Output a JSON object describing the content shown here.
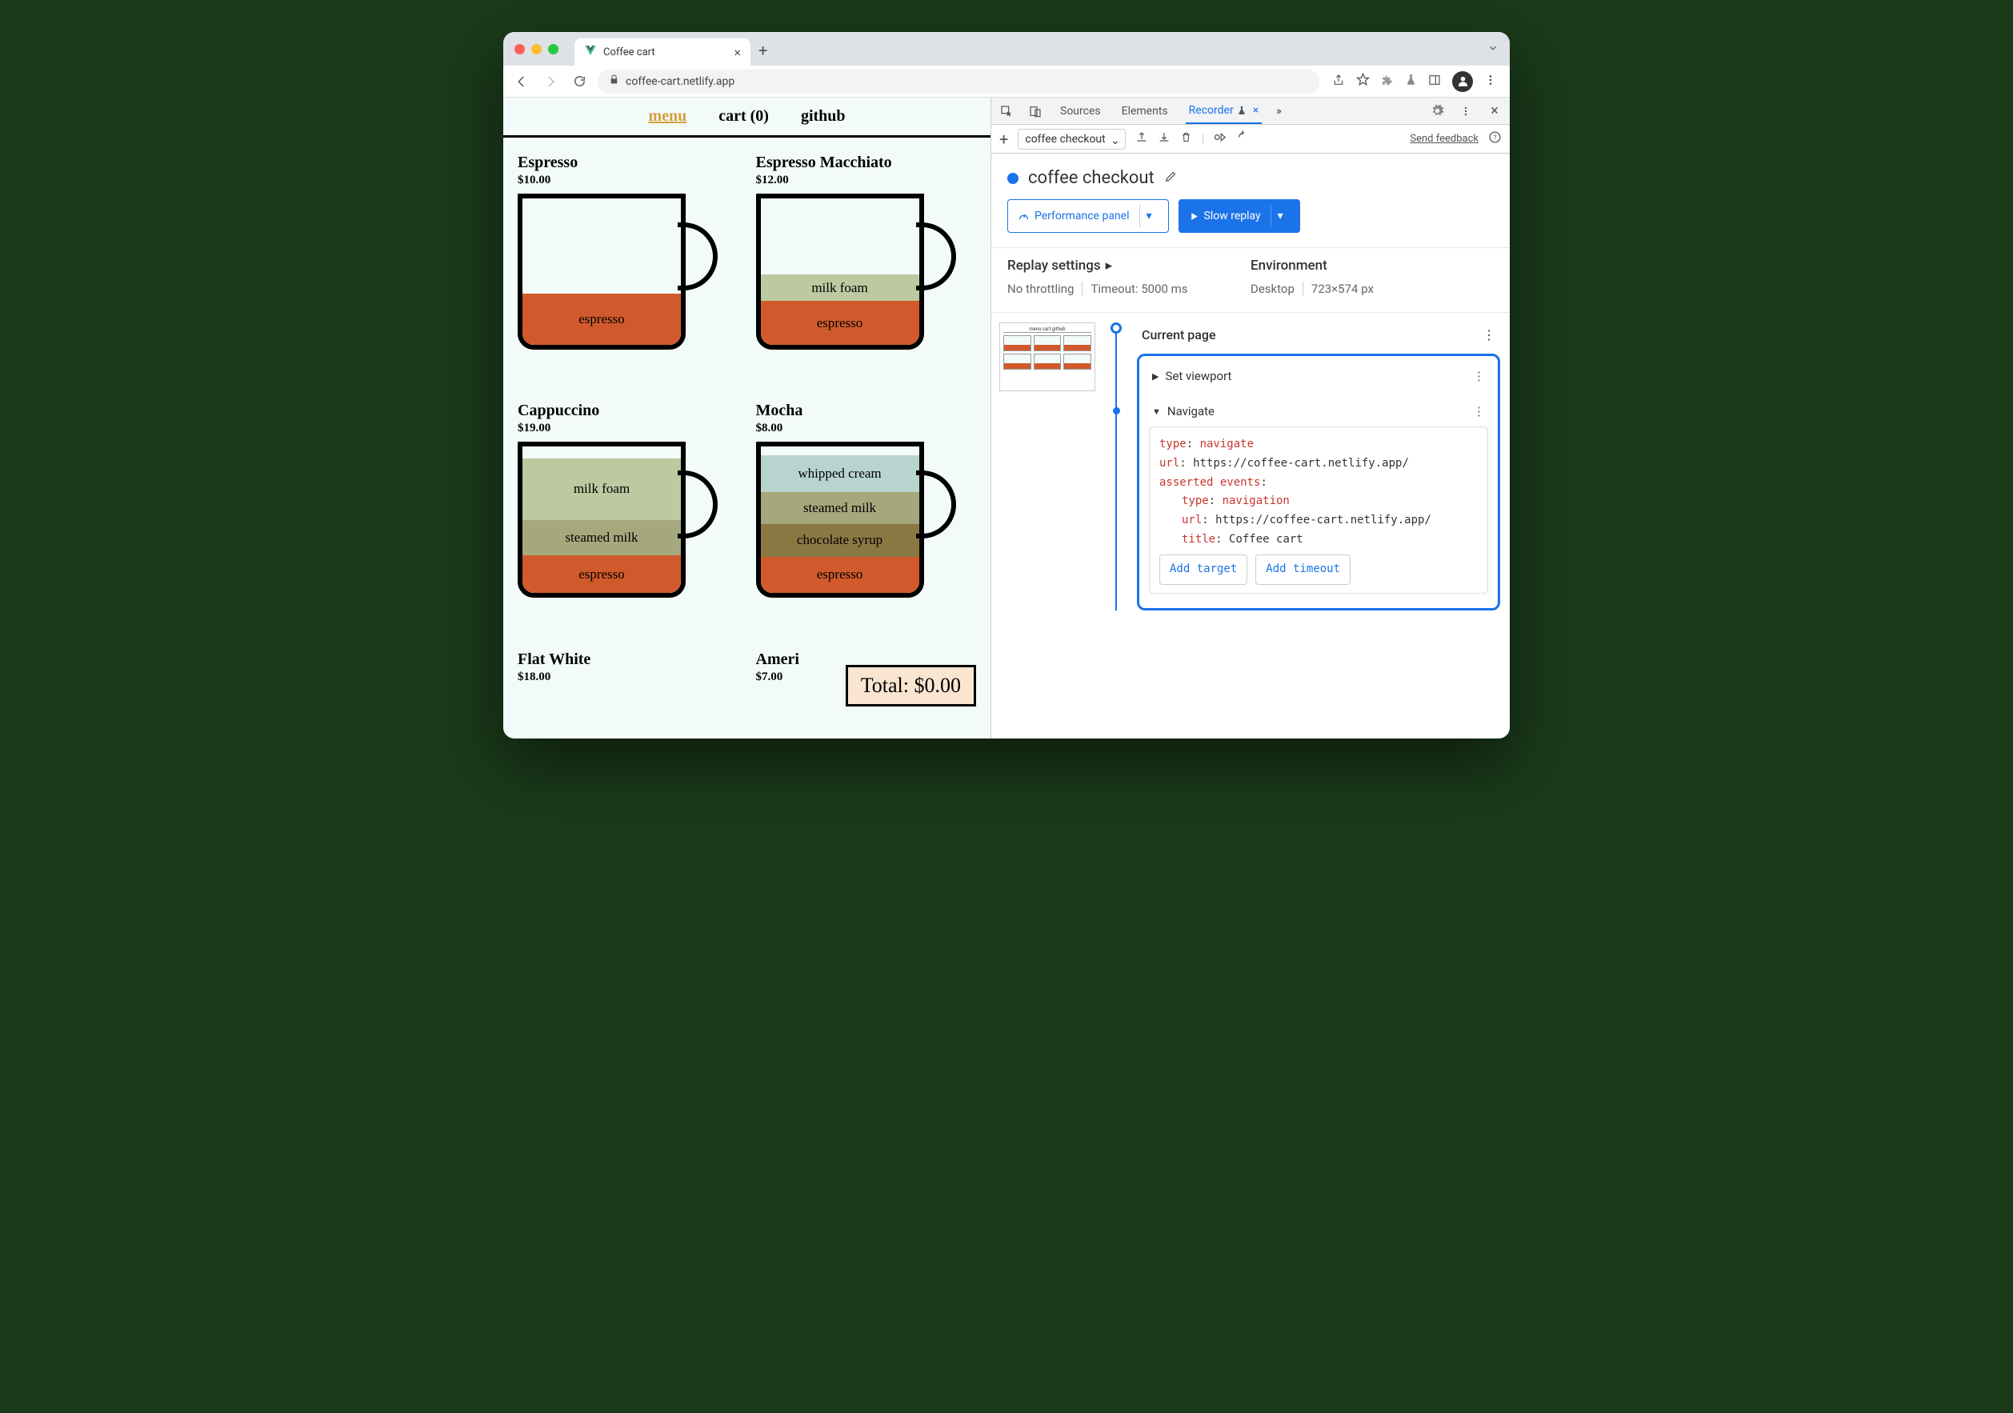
{
  "browser": {
    "tab_title": "Coffee cart",
    "url": "coffee-cart.netlify.app"
  },
  "page": {
    "nav": {
      "menu": "menu",
      "cart": "cart (0)",
      "github": "github"
    },
    "items": [
      {
        "name": "Espresso",
        "price": "$10.00"
      },
      {
        "name": "Espresso Macchiato",
        "price": "$12.00"
      },
      {
        "name": "Cappuccino",
        "price": "$19.00"
      },
      {
        "name": "Mocha",
        "price": "$8.00"
      },
      {
        "name": "Flat White",
        "price": "$18.00"
      },
      {
        "name": "Ameri",
        "price": "$7.00"
      }
    ],
    "layers": {
      "espresso": "espresso",
      "milkfoam": "milk foam",
      "steamedmilk": "steamed milk",
      "whipped": "whipped cream",
      "chocsyrup": "chocolate syrup"
    },
    "total": "Total: $0.00"
  },
  "devtools": {
    "tabs": {
      "sources": "Sources",
      "elements": "Elements",
      "recorder": "Recorder"
    },
    "toolbar": {
      "recording_name": "coffee checkout",
      "feedback": "Send feedback"
    },
    "recording": {
      "title": "coffee checkout",
      "perf_panel": "Performance panel",
      "slow_replay": "Slow replay"
    },
    "settings": {
      "replay_title": "Replay settings",
      "throttling": "No throttling",
      "timeout": "Timeout: 5000 ms",
      "env_title": "Environment",
      "env_device": "Desktop",
      "env_size": "723×574 px"
    },
    "steps": {
      "current_page": "Current page",
      "set_viewport": "Set viewport",
      "navigate": "Navigate",
      "detail": {
        "type_k": "type",
        "type_v": "navigate",
        "url_k": "url",
        "url_v": "https://coffee-cart.netlify.app/",
        "ae_k": "asserted events",
        "ae_type_k": "type",
        "ae_type_v": "navigation",
        "ae_url_k": "url",
        "ae_url_v": "https://coffee-cart.netlify.app/",
        "ae_title_k": "title",
        "ae_title_v": "Coffee cart"
      },
      "add_target": "Add target",
      "add_timeout": "Add timeout"
    }
  }
}
